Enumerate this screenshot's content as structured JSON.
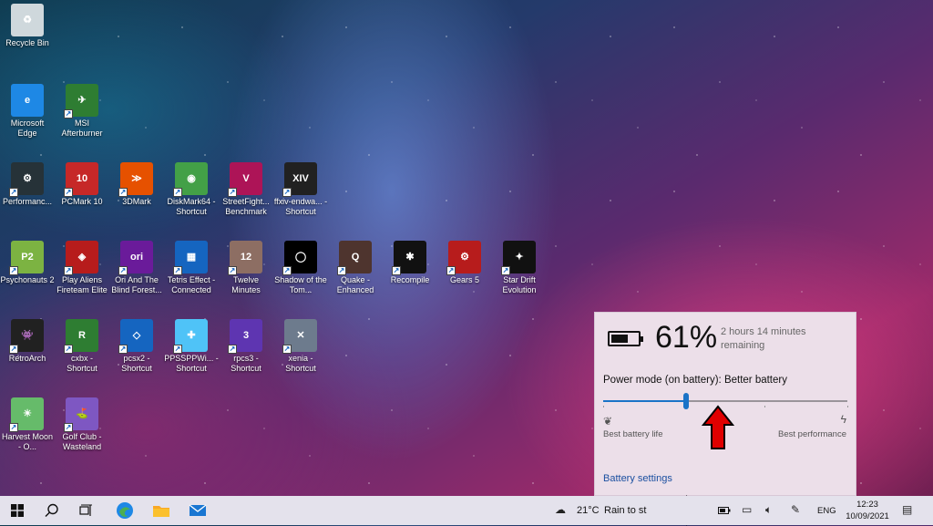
{
  "desktop": {
    "icons": [
      {
        "label": "Recycle Bin",
        "icon": "recycle-bin-icon",
        "color": "#cfd8dc",
        "glyph": "♻",
        "shortcut": false
      },
      {
        "label": "Microsoft Edge",
        "icon": "edge-icon",
        "color": "#1e88e5",
        "glyph": "e",
        "shortcut": false
      },
      {
        "label": "MSI Afterburner",
        "icon": "msi-afterburner-icon",
        "color": "#2e7d32",
        "glyph": "✈",
        "shortcut": true
      },
      {
        "label": "Performanc...",
        "icon": "performance-icon",
        "color": "#263238",
        "glyph": "⚙",
        "shortcut": true
      },
      {
        "label": "PCMark 10",
        "icon": "pcmark-icon",
        "color": "#c62828",
        "glyph": "10",
        "shortcut": true
      },
      {
        "label": "3DMark",
        "icon": "3dmark-icon",
        "color": "#e65100",
        "glyph": "≫",
        "shortcut": true
      },
      {
        "label": "DiskMark64 - Shortcut",
        "icon": "diskmark-icon",
        "color": "#43a047",
        "glyph": "◉",
        "shortcut": true
      },
      {
        "label": "StreetFight... Benchmark",
        "icon": "streetfighter-icon",
        "color": "#ad1457",
        "glyph": "V",
        "shortcut": true
      },
      {
        "label": "ffxiv-endwa... - Shortcut",
        "icon": "ffxiv-icon",
        "color": "#212121",
        "glyph": "XIV",
        "shortcut": true
      },
      {
        "label": "Psychonauts 2",
        "icon": "psychonauts-icon",
        "color": "#7cb342",
        "glyph": "P2",
        "shortcut": true
      },
      {
        "label": "Play Aliens Fireteam Elite",
        "icon": "aliens-icon",
        "color": "#b71c1c",
        "glyph": "◈",
        "shortcut": true
      },
      {
        "label": "Ori And The Blind Forest...",
        "icon": "ori-icon",
        "color": "#6a1b9a",
        "glyph": "ori",
        "shortcut": true
      },
      {
        "label": "Tetris Effect - Connected",
        "icon": "tetris-icon",
        "color": "#1565c0",
        "glyph": "▦",
        "shortcut": true
      },
      {
        "label": "Twelve Minutes",
        "icon": "twelve-minutes-icon",
        "color": "#8d6e63",
        "glyph": "12",
        "shortcut": true
      },
      {
        "label": "Shadow of the Tom...",
        "icon": "shadow-tomb-raider-icon",
        "color": "#000000",
        "glyph": "◯",
        "shortcut": true
      },
      {
        "label": "Quake - Enhanced",
        "icon": "quake-icon",
        "color": "#4e342e",
        "glyph": "Q",
        "shortcut": true
      },
      {
        "label": "Recompile",
        "icon": "recompile-icon",
        "color": "#111111",
        "glyph": "✱",
        "shortcut": true
      },
      {
        "label": "Gears 5",
        "icon": "gears5-icon",
        "color": "#b71c1c",
        "glyph": "⚙",
        "shortcut": true
      },
      {
        "label": "Star Drift Evolution",
        "icon": "star-drift-icon",
        "color": "#111111",
        "glyph": "✦",
        "shortcut": true
      },
      {
        "label": "RetroArch",
        "icon": "retroarch-icon",
        "color": "#212121",
        "glyph": "👾",
        "shortcut": true
      },
      {
        "label": "cxbx - Shortcut",
        "icon": "cxbx-icon",
        "color": "#2e7d32",
        "glyph": "R",
        "shortcut": true
      },
      {
        "label": "pcsx2 - Shortcut",
        "icon": "pcsx2-icon",
        "color": "#1565c0",
        "glyph": "◇",
        "shortcut": true
      },
      {
        "label": "PPSSPPWi... - Shortcut",
        "icon": "ppsspp-icon",
        "color": "#4fc3f7",
        "glyph": "✚",
        "shortcut": true
      },
      {
        "label": "rpcs3 - Shortcut",
        "icon": "rpcs3-icon",
        "color": "#5e35b1",
        "glyph": "3",
        "shortcut": true
      },
      {
        "label": "xenia - Shortcut",
        "icon": "xenia-icon",
        "color": "#6d7b8d",
        "glyph": "✕",
        "shortcut": true
      },
      {
        "label": "Harvest Moon - O...",
        "icon": "harvest-moon-icon",
        "color": "#66bb6a",
        "glyph": "☀",
        "shortcut": true
      },
      {
        "label": "Golf Club - Wasteland",
        "icon": "golf-club-icon",
        "color": "#7e57c2",
        "glyph": "⛳",
        "shortcut": true
      }
    ]
  },
  "battery_flyout": {
    "percent_text": "61%",
    "percent_value": 0.61,
    "remaining": "2 hours 14 minutes remaining",
    "power_mode_label": "Power mode (on battery): Better battery",
    "slider_value": 0.34,
    "left_label": "Best battery life",
    "right_label": "Best performance",
    "settings_link": "Battery settings",
    "accent": "#1a73c7"
  },
  "annotation_arrows": {
    "color": "#e00000"
  },
  "taskbar": {
    "weather_temp": "21°C",
    "weather_text": "Rain to st",
    "language": "ENG",
    "time": "12:23",
    "date": "10/09/2021",
    "pinned": [
      {
        "name": "start-button",
        "icon": "windows-icon"
      },
      {
        "name": "search-button",
        "icon": "search-icon"
      },
      {
        "name": "task-view-button",
        "icon": "task-view-icon"
      },
      {
        "name": "edge-taskbar-button",
        "icon": "edge-icon"
      },
      {
        "name": "file-explorer-button",
        "icon": "folder-icon"
      },
      {
        "name": "mail-button",
        "icon": "mail-icon"
      }
    ]
  }
}
